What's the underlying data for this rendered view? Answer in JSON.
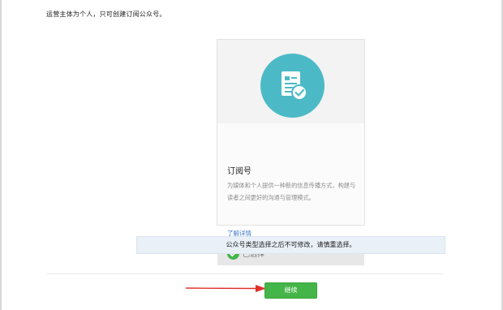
{
  "notice": "运营主体为个人，只可创建订阅公众号。",
  "card": {
    "title": "订阅号",
    "description": "为媒体和个人提供一种新的信息传播方式，构建与读者之间更好的沟通与管理模式。",
    "link": "了解详情",
    "selected_label": "已选择",
    "icon": "subscription-document-check-icon",
    "accent_color": "#4cbac6"
  },
  "warning": "公众号类型选择之后不可修改，请慎重选择。",
  "continue_button": "继续",
  "colors": {
    "primary_green": "#44b549",
    "link_blue": "#3d79c9",
    "annotation_red": "#e0302a"
  }
}
